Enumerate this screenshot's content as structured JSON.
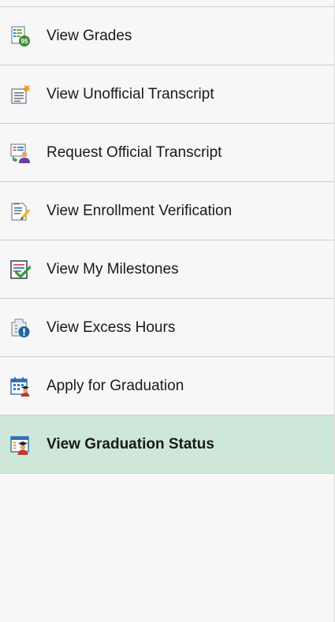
{
  "menu": {
    "items": [
      {
        "label": "View Grades",
        "icon": "grades-icon",
        "active": false
      },
      {
        "label": "View Unofficial Transcript",
        "icon": "unofficial-transcript-icon",
        "active": false
      },
      {
        "label": "Request Official Transcript",
        "icon": "official-transcript-icon",
        "active": false
      },
      {
        "label": "View Enrollment Verification",
        "icon": "enrollment-verification-icon",
        "active": false
      },
      {
        "label": "View My Milestones",
        "icon": "milestones-icon",
        "active": false
      },
      {
        "label": "View Excess Hours",
        "icon": "excess-hours-icon",
        "active": false
      },
      {
        "label": "Apply for Graduation",
        "icon": "apply-graduation-icon",
        "active": false
      },
      {
        "label": "View Graduation Status",
        "icon": "graduation-status-icon",
        "active": true
      }
    ],
    "grades_badge": "95"
  },
  "colors": {
    "panel_bg": "#f7f7f7",
    "active_bg": "#cde8d9",
    "divider": "#cfcfcf"
  }
}
